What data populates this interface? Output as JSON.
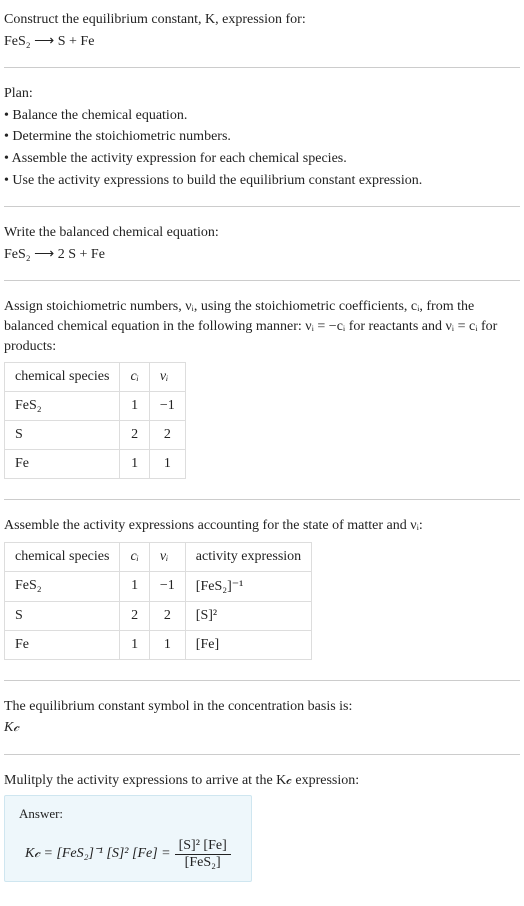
{
  "header": {
    "line1": "Construct the equilibrium constant, K, expression for:",
    "equation_unbalanced": "FeS₂ ⟶ S + Fe"
  },
  "plan": {
    "title": "Plan:",
    "bullets": [
      "• Balance the chemical equation.",
      "• Determine the stoichiometric numbers.",
      "• Assemble the activity expression for each chemical species.",
      "• Use the activity expressions to build the equilibrium constant expression."
    ]
  },
  "balanced": {
    "intro": "Write the balanced chemical equation:",
    "equation": "FeS₂ ⟶ 2 S + Fe"
  },
  "stoich": {
    "intro": "Assign stoichiometric numbers, νᵢ, using the stoichiometric coefficients, cᵢ, from the balanced chemical equation in the following manner: νᵢ = −cᵢ for reactants and νᵢ = cᵢ for products:",
    "headers": {
      "species": "chemical species",
      "ci": "cᵢ",
      "vi": "νᵢ"
    },
    "rows": [
      {
        "species": "FeS₂",
        "ci": "1",
        "vi": "−1"
      },
      {
        "species": "S",
        "ci": "2",
        "vi": "2"
      },
      {
        "species": "Fe",
        "ci": "1",
        "vi": "1"
      }
    ]
  },
  "activity": {
    "intro": "Assemble the activity expressions accounting for the state of matter and νᵢ:",
    "headers": {
      "species": "chemical species",
      "ci": "cᵢ",
      "vi": "νᵢ",
      "expr": "activity expression"
    },
    "rows": [
      {
        "species": "FeS₂",
        "ci": "1",
        "vi": "−1",
        "expr": "[FeS₂]⁻¹"
      },
      {
        "species": "S",
        "ci": "2",
        "vi": "2",
        "expr": "[S]²"
      },
      {
        "species": "Fe",
        "ci": "1",
        "vi": "1",
        "expr": "[Fe]"
      }
    ]
  },
  "symbol": {
    "intro": "The equilibrium constant symbol in the concentration basis is:",
    "value": "K𝒸"
  },
  "final": {
    "intro": "Mulitply the activity expressions to arrive at the K𝒸 expression:",
    "answer_label": "Answer:",
    "lhs": "K𝒸 = [FeS₂]⁻¹ [S]² [Fe] =",
    "num": "[S]² [Fe]",
    "den": "[FeS₂]"
  },
  "chart_data": {
    "type": "table",
    "tables": [
      {
        "title": "stoichiometric numbers",
        "columns": [
          "chemical species",
          "c_i",
          "ν_i"
        ],
        "rows": [
          [
            "FeS2",
            1,
            -1
          ],
          [
            "S",
            2,
            2
          ],
          [
            "Fe",
            1,
            1
          ]
        ]
      },
      {
        "title": "activity expressions",
        "columns": [
          "chemical species",
          "c_i",
          "ν_i",
          "activity expression"
        ],
        "rows": [
          [
            "FeS2",
            1,
            -1,
            "[FeS2]^-1"
          ],
          [
            "S",
            2,
            2,
            "[S]^2"
          ],
          [
            "Fe",
            1,
            1,
            "[Fe]"
          ]
        ]
      }
    ]
  }
}
